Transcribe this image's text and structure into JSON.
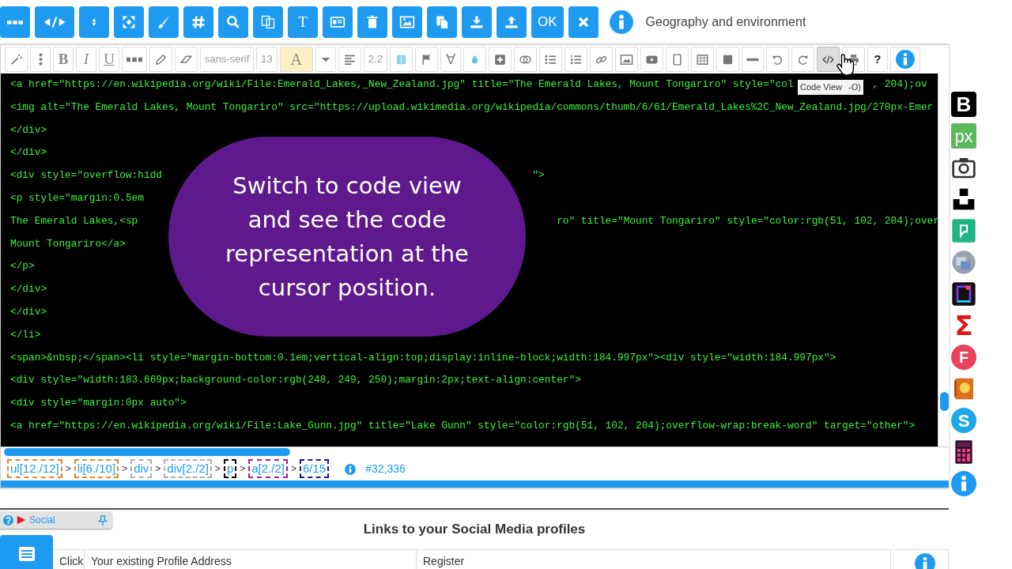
{
  "top_toolbar": {
    "buttons": [
      {
        "kind": "icon"
      },
      {
        "kind": "icon"
      },
      {
        "kind": "icon"
      },
      {
        "kind": "icon"
      },
      {
        "kind": "icon"
      },
      {
        "kind": "icon"
      },
      {
        "kind": "icon"
      },
      {
        "kind": "icon"
      },
      {
        "kind": "text",
        "label": "T"
      },
      {
        "kind": "icon"
      },
      {
        "kind": "icon"
      },
      {
        "kind": "icon"
      },
      {
        "kind": "icon"
      },
      {
        "kind": "icon"
      },
      {
        "kind": "icon"
      },
      {
        "kind": "text",
        "label": "OK"
      },
      {
        "kind": "icon"
      }
    ],
    "title": "Geography and environment"
  },
  "editor_toolbar": [
    {
      "kind": "icon",
      "selected": false
    },
    {
      "kind": "icon",
      "selected": false
    },
    {
      "kind": "bold",
      "label": "B",
      "selected": false
    },
    {
      "kind": "italic",
      "label": "I",
      "selected": false
    },
    {
      "kind": "underline",
      "label": "U",
      "selected": false
    },
    {
      "kind": "icon",
      "selected": false
    },
    {
      "kind": "icon",
      "selected": false
    },
    {
      "kind": "icon",
      "selected": false
    },
    {
      "kind": "field",
      "label": "sans-serif",
      "selected": false
    },
    {
      "kind": "field",
      "label": "13",
      "selected": false
    },
    {
      "kind": "serif",
      "label": "A",
      "selected": true
    },
    {
      "kind": "icon",
      "selected": false
    },
    {
      "kind": "icon",
      "selected": false
    },
    {
      "kind": "field",
      "label": "2.2",
      "selected": false
    },
    {
      "kind": "icon",
      "selected": false
    },
    {
      "kind": "icon",
      "selected": false
    },
    {
      "kind": "text",
      "label": "∀",
      "selected": false
    },
    {
      "kind": "icon",
      "selected": false
    },
    {
      "kind": "icon",
      "selected": false
    },
    {
      "kind": "icon",
      "selected": false
    },
    {
      "kind": "icon",
      "selected": false
    },
    {
      "kind": "icon",
      "selected": false
    },
    {
      "kind": "icon",
      "selected": false
    },
    {
      "kind": "icon",
      "selected": false
    },
    {
      "kind": "icon",
      "selected": false
    },
    {
      "kind": "icon",
      "selected": false
    },
    {
      "kind": "icon",
      "selected": false
    },
    {
      "kind": "icon",
      "selected": false
    },
    {
      "kind": "icon",
      "selected": false
    },
    {
      "kind": "icon",
      "selected": false
    },
    {
      "kind": "icon",
      "selected": false
    },
    {
      "kind": "icon",
      "selected": true
    },
    {
      "kind": "icon",
      "selected": false
    },
    {
      "kind": "bold",
      "label": "?",
      "selected": false
    },
    {
      "kind": "icon",
      "selected": false
    }
  ],
  "tooltip": {
    "parts": [
      "Code View",
      "-O)"
    ]
  },
  "code_lines": [
    {
      "segments": [
        "<a href=\"https://en.wikipedia.org/wiki/File:Emerald_Lakes,_New_Zealand.jpg\" title=\"The Emerald Lakes, Mount Tongariro\" style=\"col",
        ", 204);ov"
      ]
    },
    {
      "segments": [
        "<img alt=\"The Emerald Lakes, Mount Tongariro\" src=\"https://upload.wikimedia.org/wikipedia/commons/thumb/6/61/Emerald_Lakes%2C_New_Zealand.jpg/270px-Emer"
      ]
    },
    {
      "segments": [
        "</div>"
      ]
    },
    {
      "segments": [
        "</div>"
      ]
    },
    {
      "segments": [
        "<div style=\"overflow:hidd",
        "\">"
      ]
    },
    {
      "segments": [
        "<p style=\"margin:0.5em"
      ]
    },
    {
      "segments": [
        "The Emerald Lakes,<sp",
        "ro\" title=\"Mount Tongariro\" style=\"color:rgb(51, 102, 204);over"
      ]
    },
    {
      "segments": [
        "Mount Tongariro</a>"
      ]
    },
    {
      "segments": [
        "</p>"
      ]
    },
    {
      "segments": [
        "</div>"
      ]
    },
    {
      "segments": [
        "</div>"
      ]
    },
    {
      "segments": [
        "</li>"
      ]
    },
    {
      "segments": [
        "<span>&nbsp;</span><li style=\"margin-bottom:0.1em;vertical-align:top;display:inline-block;width:184.997px\"><div style=\"width:184.997px\">"
      ]
    },
    {
      "segments": [
        "<div style=\"width:183.669px;background-color:rgb(248, 249, 250);margin:2px;text-align:center\">"
      ]
    },
    {
      "segments": [
        "<div style=\"margin:0px auto\">"
      ]
    },
    {
      "segments": [
        "<a href=\"https://en.wikipedia.org/wiki/File:Lake_Gunn.jpg\" title=\"Lake Gunn\" style=\"color:rgb(51, 102, 204);overflow-wrap:break-word\" target=\"other\">"
      ]
    }
  ],
  "callout": {
    "text": "Switch to code view and see the code representation at the cursor position."
  },
  "breadcrumb": [
    {
      "text": "ul[12./12]",
      "color": "#e08a2c"
    },
    {
      "sep": ">",
      "text": "li[6./10]",
      "color": "#e08a2c"
    },
    {
      "sep": ">",
      "text": "div",
      "color": "#b0b0b0"
    },
    {
      "sep": ">",
      "text": "div[2./2]",
      "color": "#b0b0b0"
    },
    {
      "sep": ">",
      "text": "p",
      "color": "#000000"
    },
    {
      "sep": ">",
      "text": "a[2./2]",
      "color": "#a0209f"
    },
    {
      "sep": ">",
      "text": "6/15",
      "color": "#1a1aa0"
    }
  ],
  "position": "#32,336",
  "sidebar": [
    {
      "kind": "logo",
      "label": "B"
    },
    {
      "kind": "logo",
      "label": "px"
    },
    {
      "kind": "icon"
    },
    {
      "kind": "icon"
    },
    {
      "kind": "icon"
    },
    {
      "kind": "icon"
    },
    {
      "kind": "icon"
    },
    {
      "kind": "logo",
      "label": "Σ"
    },
    {
      "kind": "logo",
      "label": "F"
    },
    {
      "kind": "icon"
    },
    {
      "kind": "logo",
      "label": "S"
    },
    {
      "kind": "icon"
    },
    {
      "kind": "icon"
    }
  ],
  "social": {
    "tab_label": "Social",
    "heading": "Links to your Social Media profiles",
    "columns": [
      "Click",
      "Your existing Profile Address",
      "Register"
    ]
  }
}
